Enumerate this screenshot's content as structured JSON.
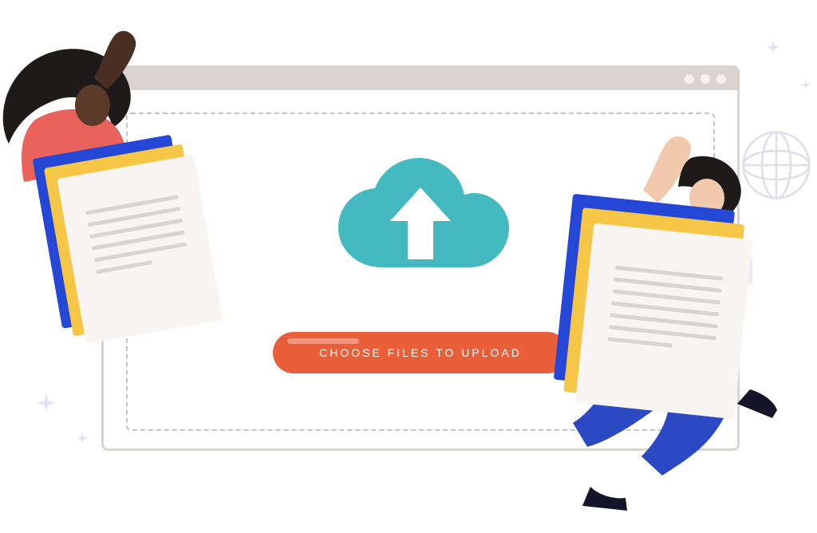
{
  "browser": {
    "window_controls_count": 3
  },
  "upload": {
    "button_label": "CHOOSE FILES TO UPLOAD"
  },
  "colors": {
    "accent_button": "#e85f3a",
    "cloud": "#45b9c0",
    "doc_blue": "#2447d6",
    "doc_yellow": "#f6c646",
    "doc_white": "#f8f4f1",
    "chrome_grey": "#d9d4d0",
    "person_shirt_left": "#e9625b",
    "person_shirt_right": "#eceaf0",
    "person_pants_right": "#2b49c2",
    "sparkle": "#e6e1f0"
  },
  "icons": {
    "cloud_upload": "cloud-upload-icon",
    "globe": "globe-icon",
    "sparkle": "sparkle-icon",
    "document_stack": "document-stack-icon",
    "window_dot": "window-control-dot-icon"
  }
}
